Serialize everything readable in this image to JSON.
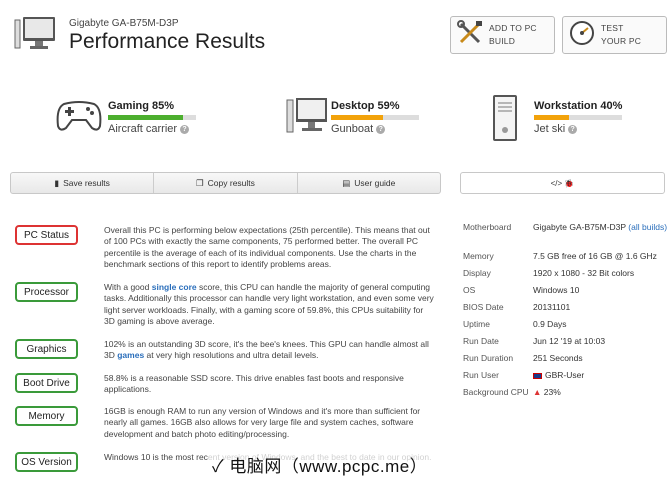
{
  "header": {
    "subtitle": "Gigabyte GA-B75M-D3P",
    "title": "Performance Results",
    "build_btn": {
      "line1": "ADD TO PC",
      "line2": "BUILD"
    },
    "test_btn": {
      "line1": "TEST",
      "line2": "YOUR PC"
    }
  },
  "scores": [
    {
      "name": "Gaming 85%",
      "label": "Aircraft carrier",
      "fill": 0.85,
      "color": "#4caf2e",
      "icon": "gamepad-icon"
    },
    {
      "name": "Desktop 59%",
      "label": "Gunboat",
      "fill": 0.59,
      "color": "#f2a20a",
      "icon": "desktop-icon"
    },
    {
      "name": "Workstation 40%",
      "label": "Jet ski",
      "fill": 0.4,
      "color": "#f2a20a",
      "icon": "tower-icon"
    }
  ],
  "toolbar": {
    "save": "Save results",
    "copy": "Copy results",
    "guide": "User guide",
    "embed": "</> 🐞"
  },
  "rows": [
    {
      "label": "PC Status",
      "status": "red",
      "text": "Overall this PC is performing below expectations (25th percentile). This means that out of 100 PCs with exactly the same components, 75 performed better. The overall PC percentile is the average of each of its individual components. Use the charts in the benchmark sections of this report to identify problems areas."
    },
    {
      "label": "Processor",
      "status": "green",
      "text_a": "With a good ",
      "link": "single core",
      "text_b": " score, this CPU can handle the majority of general computing tasks. Additionally this processor can handle very light workstation, and even some very light server workloads. Finally, with a gaming score of 59.8%, this CPUs suitability for 3D gaming is above average."
    },
    {
      "label": "Graphics",
      "status": "green",
      "text_a": "102% is an outstanding 3D score, it's the bee's knees. This GPU can handle almost all 3D ",
      "link": "games",
      "text_b": " at very high resolutions and ultra detail levels."
    },
    {
      "label": "Boot Drive",
      "status": "green",
      "text": "58.8% is a reasonable SSD score. This drive enables fast boots and responsive applications."
    },
    {
      "label": "Memory",
      "status": "green",
      "text": "16GB is enough RAM to run any version of Windows and it's more than sufficient for nearly all games. 16GB also allows for very large file and system caches, software development and batch photo editing/processing."
    },
    {
      "label": "OS Version",
      "status": "green",
      "text": "Windows 10 is the most recent version of Windows, and the best to date in our opinion."
    }
  ],
  "specs": {
    "motherboard_k": "Motherboard",
    "motherboard_v": "Gigabyte GA-B75M-D3P",
    "motherboard_link": "(all builds)",
    "memory_k": "Memory",
    "memory_v": "7.5 GB free of 16 GB @ 1.6 GHz",
    "display_k": "Display",
    "display_v": "1920 x 1080 - 32 Bit colors",
    "os_k": "OS",
    "os_v": "Windows 10",
    "bios_k": "BIOS Date",
    "bios_v": "20131101",
    "uptime_k": "Uptime",
    "uptime_v": "0.9 Days",
    "rundate_k": "Run Date",
    "rundate_v": "Jun 12 '19 at 10:03",
    "runduration_k": "Run Duration",
    "runduration_v": "251 Seconds",
    "runuser_k": "Run User",
    "runuser_v": "GBR-User",
    "bgcpu_k": "Background CPU",
    "bgcpu_v": "23%"
  },
  "watermark": "✓ 电脑网（www.pcpc.me）"
}
